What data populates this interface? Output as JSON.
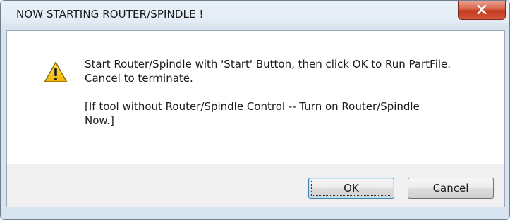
{
  "window": {
    "title": "NOW STARTING ROUTER/SPINDLE !"
  },
  "title_bar": {
    "close_icon": "close-x-icon"
  },
  "message": {
    "icon": "warning-icon",
    "line1": "Start Router/Spindle with 'Start' Button, then click OK to Run PartFile.",
    "line2": "Cancel to terminate.",
    "line3": "[If tool without Router/Spindle Control -- Turn on Router/Spindle",
    "line4": "Now.]"
  },
  "buttons": {
    "ok_label": "OK",
    "cancel_label": "Cancel"
  },
  "colors": {
    "close_button": "#c8452c",
    "warning_fill": "#f5c800",
    "default_button_border": "#3c7fb1"
  }
}
